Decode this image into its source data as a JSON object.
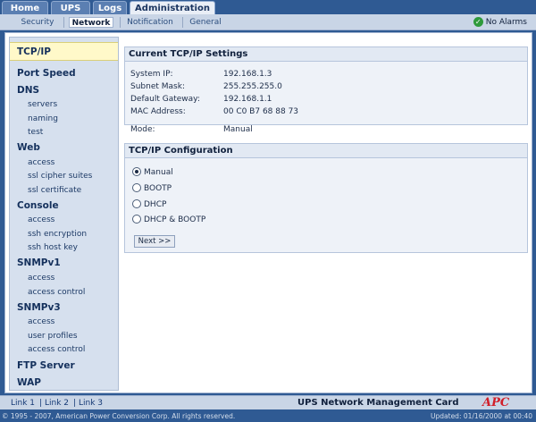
{
  "top_tabs": {
    "home": "Home",
    "ups": "UPS",
    "logs": "Logs",
    "administration": "Administration"
  },
  "sub_tabs": {
    "security": "Security",
    "network": "Network",
    "notification": "Notification",
    "general": "General"
  },
  "alarm": {
    "icon": "check-icon",
    "label": "No Alarms",
    "color": "#2e9a3b"
  },
  "sidenav": {
    "tcpip": "TCP/IP",
    "port_speed": "Port Speed",
    "dns": "DNS",
    "dns_servers": "servers",
    "dns_naming": "naming",
    "dns_test": "test",
    "web": "Web",
    "web_access": "access",
    "web_ssl_cipher": "ssl cipher suites",
    "web_ssl_cert": "ssl certificate",
    "console": "Console",
    "console_access": "access",
    "console_ssh_enc": "ssh encryption",
    "console_ssh_host": "ssh host key",
    "snmpv1": "SNMPv1",
    "snmpv1_access": "access",
    "snmpv1_access_control": "access control",
    "snmpv3": "SNMPv3",
    "snmpv3_access": "access",
    "snmpv3_user_profiles": "user profiles",
    "snmpv3_access_control": "access control",
    "ftp_server": "FTP Server",
    "wap": "WAP"
  },
  "current_settings": {
    "title": "Current TCP/IP Settings",
    "system_ip_label": "System IP:",
    "system_ip": "192.168.1.3",
    "subnet_mask_label": "Subnet Mask:",
    "subnet_mask": "255.255.255.0",
    "gateway_label": "Default Gateway:",
    "gateway": "192.168.1.1",
    "mac_label": "MAC Address:",
    "mac": "00 C0 B7 68 88 73",
    "mode_label": "Mode:",
    "mode": "Manual"
  },
  "configuration": {
    "title": "TCP/IP Configuration",
    "options": [
      "Manual",
      "BOOTP",
      "DHCP",
      "DHCP & BOOTP"
    ],
    "selected": "Manual",
    "next_button": "Next >>"
  },
  "footer": {
    "link1": "Link 1",
    "link2": "Link 2",
    "link3": "Link 3",
    "separator": "|",
    "card_title": "UPS Network Management Card",
    "logo": "APC",
    "copyright": "© 1995 - 2007, American Power Conversion Corp. All rights reserved.",
    "updated": "Updated: 01/16/2000 at 00:40"
  }
}
